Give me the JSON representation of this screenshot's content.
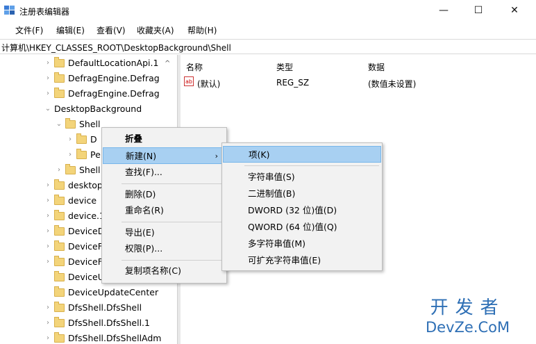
{
  "window": {
    "title": "注册表编辑器",
    "minimize": "—",
    "maximize": "☐",
    "close": "✕"
  },
  "menubar": [
    "文件(F)",
    "编辑(E)",
    "查看(V)",
    "收藏夹(A)",
    "帮助(H)"
  ],
  "address": "计算机\\HKEY_CLASSES_ROOT\\DesktopBackground\\Shell",
  "tree": {
    "rows": [
      {
        "label": "DefaultLocationApi.1",
        "expander": "›"
      },
      {
        "label": "DefragEngine.Defrag",
        "expander": "›"
      },
      {
        "label": "DefragEngine.Defrag",
        "expander": "›"
      },
      {
        "label": "DesktopBackground",
        "expander": "⌄",
        "nofolder": true
      },
      {
        "label": "Shell",
        "expander": "⌄"
      },
      {
        "label": "D",
        "expander": "›"
      },
      {
        "label": "Pe",
        "expander": "›"
      },
      {
        "label": "Shell",
        "expander": "›"
      },
      {
        "label": "desktop",
        "expander": "›"
      },
      {
        "label": "device",
        "expander": "›"
      },
      {
        "label": "device.1",
        "expander": "›"
      },
      {
        "label": "DeviceD",
        "expander": "›"
      },
      {
        "label": "DeviceF",
        "expander": "›"
      },
      {
        "label": "DeviceF",
        "expander": "›"
      },
      {
        "label": "DeviceU",
        "expander": ""
      },
      {
        "label": "DeviceUpdateCenter",
        "expander": ""
      },
      {
        "label": "DfsShell.DfsShell",
        "expander": "›"
      },
      {
        "label": "DfsShell.DfsShell.1",
        "expander": "›"
      },
      {
        "label": "DfsShell.DfsShellAdm",
        "expander": "›"
      }
    ]
  },
  "values": {
    "headers": {
      "name": "名称",
      "type": "类型",
      "data": "数据"
    },
    "rows": [
      {
        "icon": "ab",
        "name": "(默认)",
        "type": "REG_SZ",
        "data": "(数值未设置)"
      }
    ]
  },
  "context_menu": {
    "collapse": "折叠",
    "new": "新建(N)",
    "find": "查找(F)...",
    "delete": "删除(D)",
    "rename": "重命名(R)",
    "export": "导出(E)",
    "permissions": "权限(P)...",
    "copy_key_name": "复制项名称(C)",
    "submenu_arrow": "›"
  },
  "submenu": {
    "key": "项(K)",
    "string_value": "字符串值(S)",
    "binary_value": "二进制值(B)",
    "dword_value": "DWORD (32 位)值(D)",
    "qword_value": "QWORD (64 位)值(Q)",
    "multi_string_value": "多字符串值(M)",
    "expandable_string_value": "可扩充字符串值(E)"
  },
  "watermark": {
    "line1": "开发者",
    "line2": "DevZe.CoM"
  },
  "colors": {
    "highlight": "#a8d0f2",
    "folder": "#f3d47a",
    "watermark": "#2e6fb5"
  }
}
